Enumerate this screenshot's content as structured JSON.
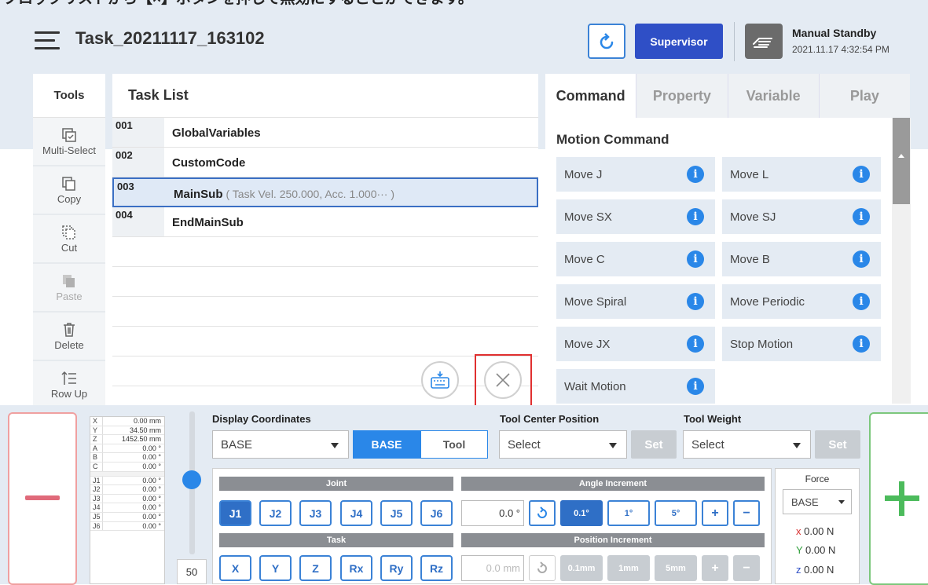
{
  "caption": "ブロックリストから【×】ボタンを押して無効にすることができます。",
  "header": {
    "task_title": "Task_20211117_163102",
    "supervisor_label": "Supervisor",
    "mode_label": "Manual Standby",
    "datetime": "2021.11.17 4:32:54 PM"
  },
  "tools": {
    "title": "Tools",
    "items": [
      "Multi-Select",
      "Copy",
      "Cut",
      "Paste",
      "Delete",
      "Row Up"
    ]
  },
  "task_list": {
    "title": "Task List",
    "rows": [
      {
        "num": "001",
        "name": "GlobalVariables",
        "sub": ""
      },
      {
        "num": "002",
        "name": "CustomCode",
        "sub": ""
      },
      {
        "num": "003",
        "name": "MainSub",
        "sub": "( Task Vel. 250.000, Acc. 1.000··· )"
      },
      {
        "num": "004",
        "name": "EndMainSub",
        "sub": ""
      }
    ]
  },
  "command_panel": {
    "tabs": [
      "Command",
      "Property",
      "Variable",
      "Play"
    ],
    "section_title": "Motion Command",
    "commands": [
      "Move J",
      "Move L",
      "Move SX",
      "Move SJ",
      "Move C",
      "Move B",
      "Move Spiral",
      "Move Periodic",
      "Move JX",
      "Stop Motion",
      "Wait Motion"
    ],
    "info_glyph": "i"
  },
  "coords": [
    {
      "k": "X",
      "v": "0.00 mm"
    },
    {
      "k": "Y",
      "v": "34.50 mm"
    },
    {
      "k": "Z",
      "v": "1452.50 mm"
    },
    {
      "k": "A",
      "v": "0.00 °"
    },
    {
      "k": "B",
      "v": "0.00 °"
    },
    {
      "k": "C",
      "v": "0.00 °"
    },
    {
      "k": "J1",
      "v": "0.00 °"
    },
    {
      "k": "J2",
      "v": "0.00 °"
    },
    {
      "k": "J3",
      "v": "0.00 °"
    },
    {
      "k": "J4",
      "v": "0.00 °"
    },
    {
      "k": "J5",
      "v": "0.00 °"
    },
    {
      "k": "J6",
      "v": "0.00 °"
    }
  ],
  "speed": "50",
  "display_coords": {
    "label": "Display Coordinates",
    "select_value": "BASE",
    "seg_base": "BASE",
    "seg_tool": "Tool"
  },
  "tcp": {
    "label": "Tool Center Position",
    "select_value": "Select",
    "set_label": "Set"
  },
  "tool_weight": {
    "label": "Tool Weight",
    "select_value": "Select",
    "set_label": "Set"
  },
  "jog": {
    "joint_label": "Joint",
    "joints": [
      "J1",
      "J2",
      "J3",
      "J4",
      "J5",
      "J6"
    ],
    "task_label": "Task",
    "task_axes": [
      "X",
      "Y",
      "Z",
      "Rx",
      "Ry",
      "Rz"
    ],
    "angle_label": "Angle Increment",
    "angle_value": "0.0 °",
    "angle_steps": [
      "0.1°",
      "1°",
      "5°"
    ],
    "pos_label": "Position Increment",
    "pos_value": "0.0 mm",
    "pos_steps": [
      "0.1mm",
      "1mm",
      "5mm"
    ],
    "plus": "+",
    "minus": "−"
  },
  "force": {
    "title": "Force",
    "select_value": "BASE",
    "x": "x 0.00 N",
    "y": "Y 0.00 N",
    "z": "z 0.00 N",
    "colors": {
      "x": "#d93030",
      "y": "#2f9e3a",
      "z": "#2f4fc6"
    }
  }
}
